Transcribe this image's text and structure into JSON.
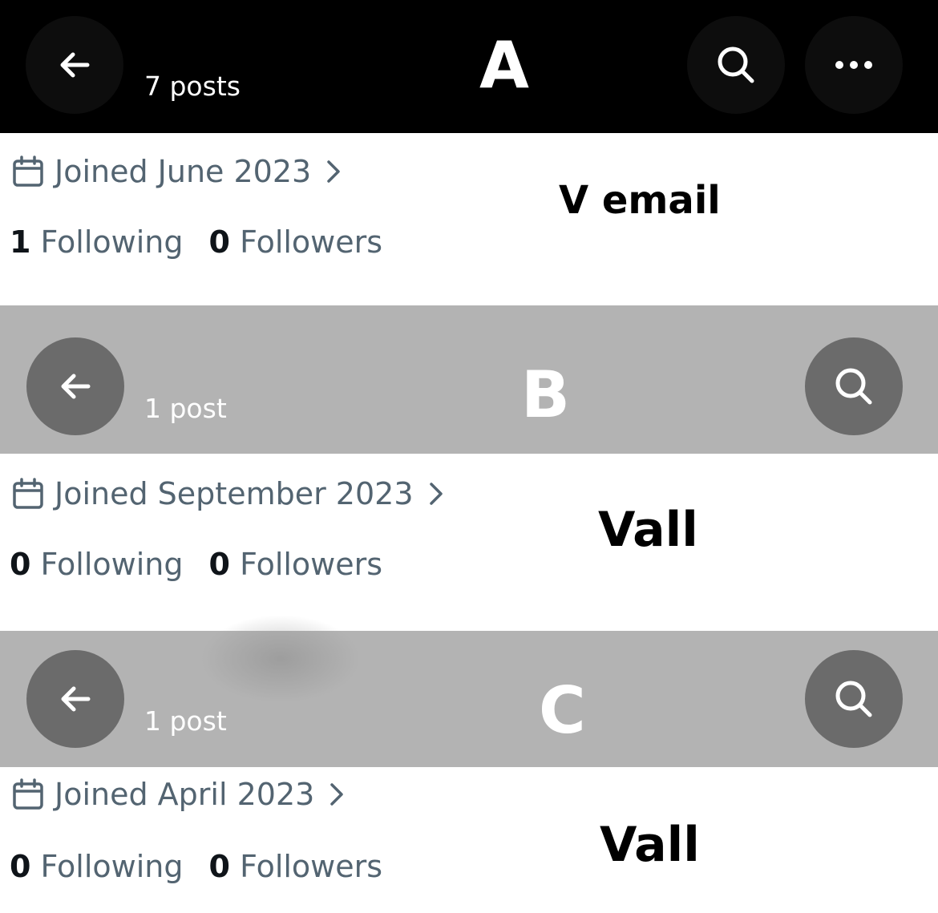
{
  "panels": [
    {
      "letter": "A",
      "posts_count": "7 posts",
      "joined": "Joined June 2023",
      "following_count": "1",
      "following_label": "Following",
      "followers_count": "0",
      "followers_label": "Followers",
      "note": "V email",
      "header_bg": "#000000"
    },
    {
      "letter": "B",
      "posts_count": "1 post",
      "joined": "Joined September 2023",
      "following_count": "0",
      "following_label": "Following",
      "followers_count": "0",
      "followers_label": "Followers",
      "note": "Vall",
      "header_bg": "#b3b3b3"
    },
    {
      "letter": "C",
      "posts_count": "1 post",
      "joined": "Joined April 2023",
      "following_count": "0",
      "following_label": "Following",
      "followers_count": "0",
      "followers_label": "Followers",
      "note": "Vall",
      "header_bg": "#b3b3b3"
    }
  ],
  "icons": {
    "back": "arrow-left-icon",
    "search": "search-icon",
    "more": "more-horizontal-icon",
    "calendar": "calendar-icon",
    "chevron": "chevron-right-icon"
  },
  "colors": {
    "secondary_text": "#536471",
    "primary_text": "#0f1419"
  }
}
